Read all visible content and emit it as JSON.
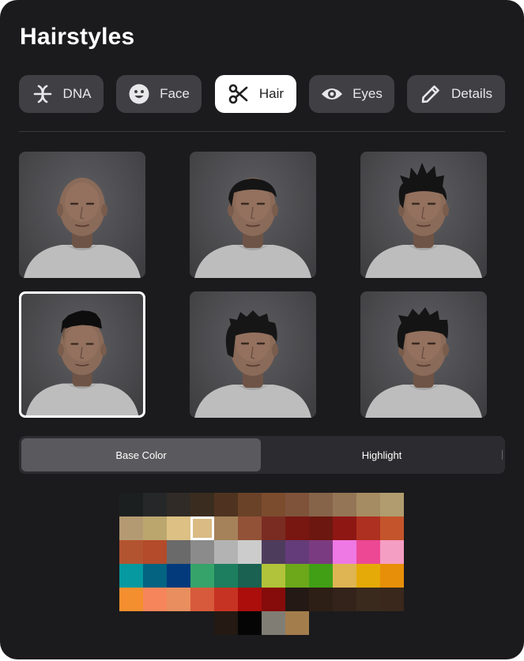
{
  "page": {
    "title": "Hairstyles"
  },
  "tabs": [
    {
      "label": "DNA",
      "icon": "dna-icon",
      "active": false
    },
    {
      "label": "Face",
      "icon": "face-icon",
      "active": false
    },
    {
      "label": "Hair",
      "icon": "scissors-icon",
      "active": true
    },
    {
      "label": "Eyes",
      "icon": "eye-icon",
      "active": false
    },
    {
      "label": "Details",
      "icon": "pencil-icon",
      "active": false
    }
  ],
  "hairstyles": [
    {
      "style": "bald",
      "selected": false
    },
    {
      "style": "short-slick",
      "selected": false
    },
    {
      "style": "spiky-top",
      "selected": false
    },
    {
      "style": "mohawk-undercut",
      "selected": true
    },
    {
      "style": "messy-medium",
      "selected": false
    },
    {
      "style": "tousled",
      "selected": false
    }
  ],
  "color_mode": {
    "options": [
      "Base Color",
      "Highlight"
    ],
    "active": "Base Color"
  },
  "palette": {
    "selected_row": 1,
    "selected_col": 3,
    "rows": [
      [
        "#1c1f20",
        "#262728",
        "#302b26",
        "#3a2c1f",
        "#4f3320",
        "#6a4228",
        "#7b4c2e",
        "#7e533a",
        "#86644a",
        "#947556",
        "#a68c62",
        "#b09c6e"
      ],
      [
        "#b49a72",
        "#bba66e",
        "#dcc084",
        "#d9bb83",
        "#a5825a",
        "#925238",
        "#7a2c22",
        "#781711",
        "#6c1710",
        "#8e1714",
        "#ae3020",
        "#c4542b"
      ],
      [
        "#b35431",
        "#b44b2a",
        "#6a6a6a",
        "#8b8b8b",
        "#b3b3b3",
        "#cccccc",
        "#4e3c5d",
        "#633c79",
        "#7b3b80",
        "#ee78e4",
        "#ec4894",
        "#f59ec3"
      ],
      [
        "#06999f",
        "#036381",
        "#033a7c",
        "#36a36b",
        "#1c7e5e",
        "#1b6152",
        "#b1c33a",
        "#6ca819",
        "#419f16",
        "#deb552",
        "#e5aa08",
        "#e78f08"
      ],
      [
        "#f38f2e",
        "#f6855b",
        "#e98e5e",
        "#d65a3b",
        "#c73322",
        "#ab0e0b",
        "#850c0b",
        "#241915",
        "#2e1f16",
        "#33231a",
        "#3a2a1d",
        "#3a281c"
      ],
      [
        "#241913",
        "#050505",
        "#807d75",
        "#a47d4d"
      ]
    ]
  }
}
